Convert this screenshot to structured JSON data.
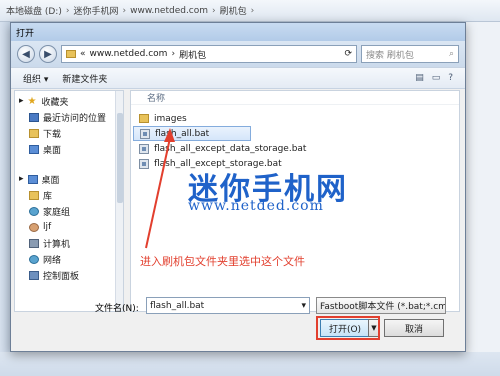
{
  "background": {
    "breadcrumb": [
      "本地磁盘 (D:)",
      "迷你手机网",
      "www.netded.com",
      "刷机包"
    ]
  },
  "dialog": {
    "title": "打开",
    "address": [
      "www.netded.com",
      "刷机包"
    ],
    "search_placeholder": "搜索 刷机包",
    "toolbar": {
      "organize": "组织 ▾",
      "new_folder": "新建文件夹"
    },
    "nav": {
      "favorites": "收藏夹",
      "favorites_items": [
        "最近访问的位置",
        "下载",
        "桌面"
      ],
      "desktop": "桌面",
      "desktop_items": [
        "库",
        "家庭组",
        "ljf",
        "计算机",
        "网络",
        "控制面板"
      ]
    },
    "files": {
      "column_name": "名称",
      "items": [
        "images",
        "flash_all.bat",
        "flash_all_except_data_storage.bat",
        "flash_all_except_storage.bat"
      ]
    },
    "filename_label": "文件名(N):",
    "filename_value": "flash_all.bat",
    "filetype_value": "Fastboot脚本文件 (*.bat;*.cmd)",
    "open_button": "打开(O)",
    "cancel_button": "取消"
  },
  "overlay": {
    "watermark_title": "迷你手机网",
    "watermark_url": "www.netded.com",
    "annotation": "进入刷机包文件夹里选中这个文件"
  },
  "colors": {
    "annotation": "#e23f2e",
    "watermark": "#1f62c9"
  }
}
